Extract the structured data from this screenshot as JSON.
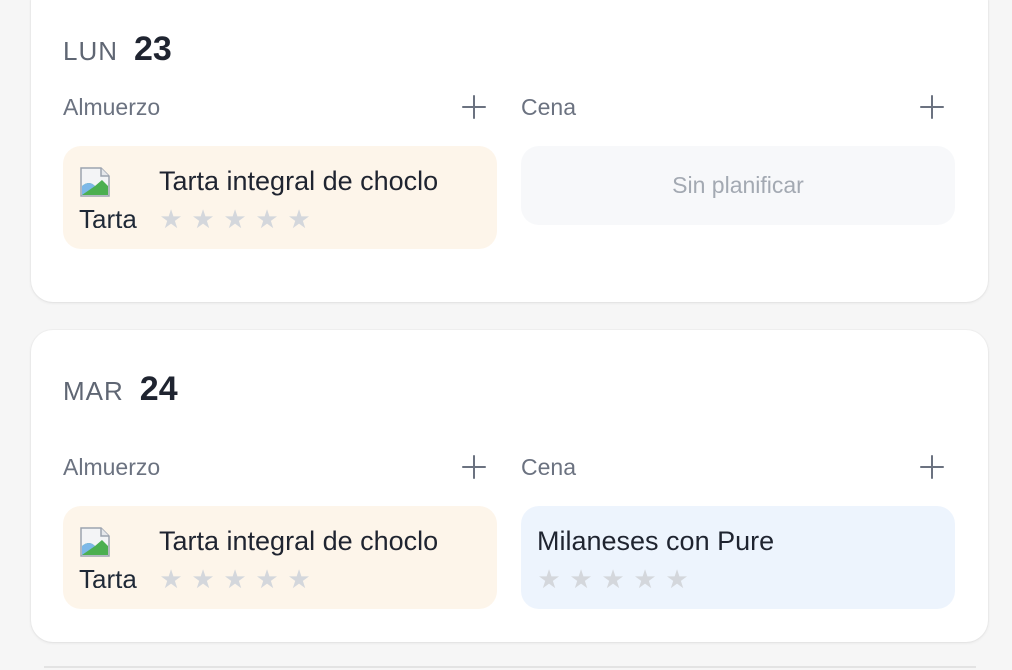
{
  "days": [
    {
      "dow": "LUN",
      "dnum": "23",
      "lunch": {
        "label": "Almuerzo",
        "title": "Tarta integral de choclo",
        "img_alt": "Tarta integral de choclo",
        "rating": 0
      },
      "dinner": {
        "label": "Cena",
        "empty_text": "Sin planificar"
      }
    },
    {
      "dow": "MAR",
      "dnum": "24",
      "lunch": {
        "label": "Almuerzo",
        "title": "Tarta integral de choclo",
        "img_alt": "Tarta integral de choclo",
        "rating": 0
      },
      "dinner": {
        "label": "Cena",
        "title": "Milaneses con Pure",
        "rating": 0
      }
    }
  ],
  "icons": {
    "add": "plus-icon",
    "star": "star-icon",
    "broken_image": "broken-image-icon"
  },
  "colors": {
    "lunch_bg": "#fdf5ea",
    "dinner_bg": "#edf4fd",
    "empty_bg": "#f7f8fa",
    "star_empty": "#d4d7dc"
  }
}
